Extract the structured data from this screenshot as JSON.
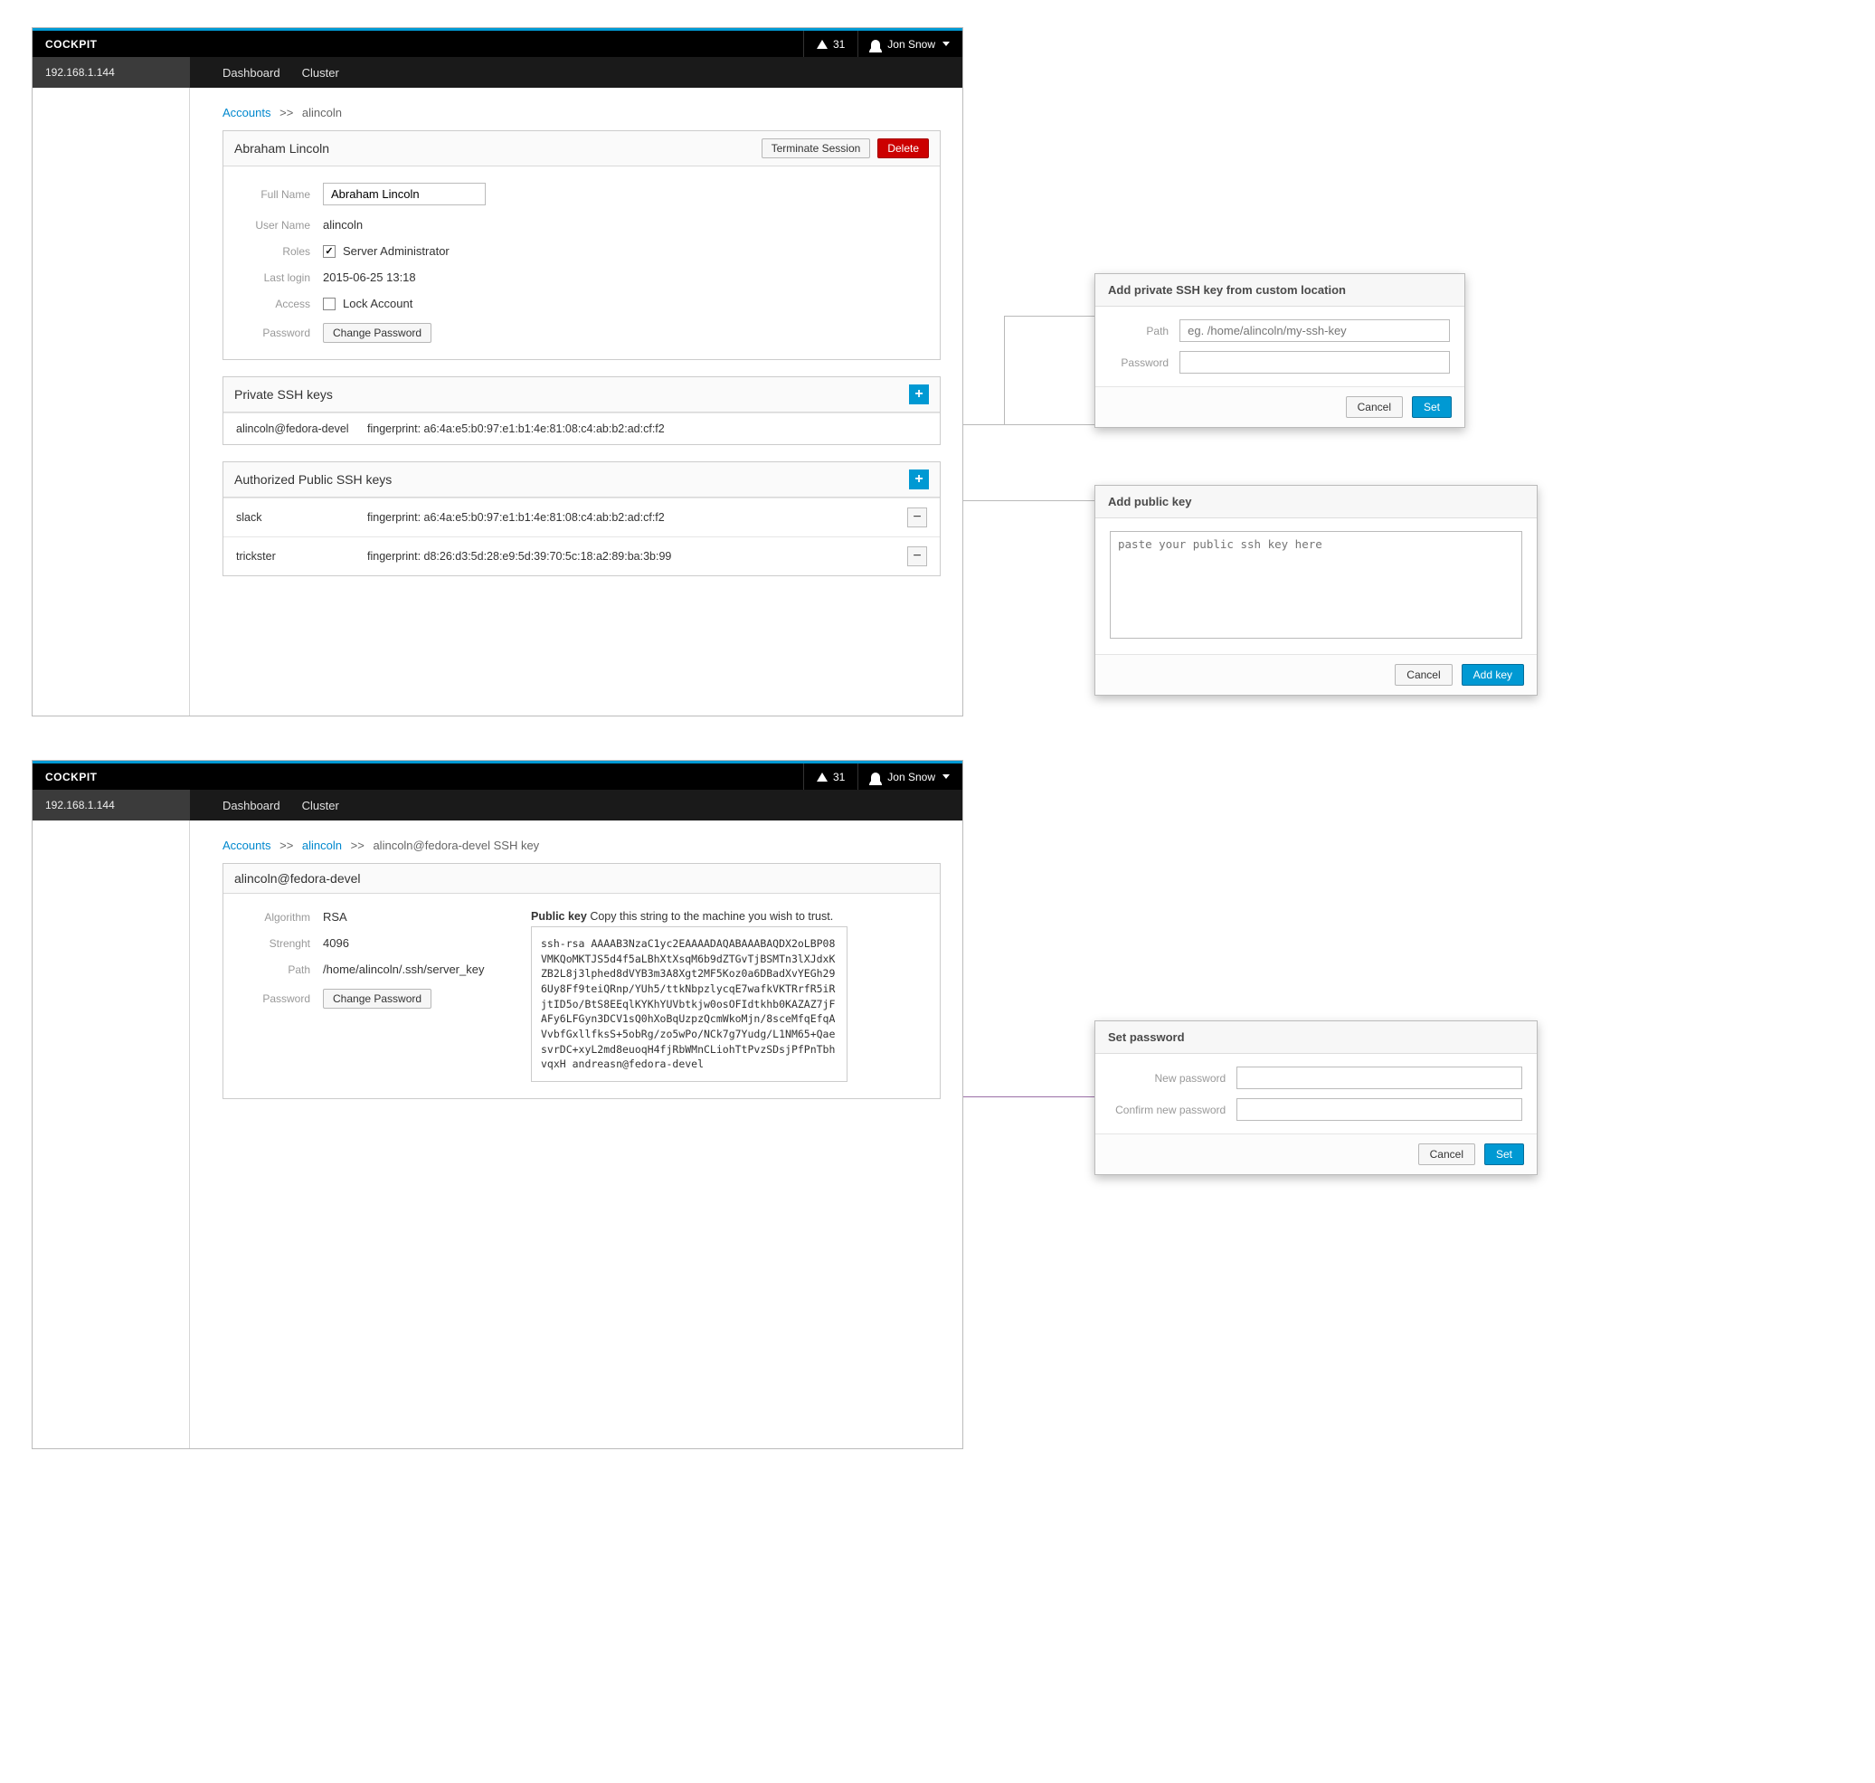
{
  "brand": "COCKPIT",
  "host": "192.168.1.144",
  "alerts": {
    "count": "31"
  },
  "user": {
    "name": "Jon Snow"
  },
  "nav": {
    "dashboard": "Dashboard",
    "cluster": "Cluster"
  },
  "screen1": {
    "breadcrumb": {
      "root": "Accounts",
      "leaf": "alincoln"
    },
    "title": "Abraham Lincoln",
    "actions": {
      "terminate": "Terminate Session",
      "delete": "Delete"
    },
    "fields": {
      "full_name_label": "Full Name",
      "full_name": "Abraham Lincoln",
      "user_name_label": "User Name",
      "user_name": "alincoln",
      "roles_label": "Roles",
      "role_admin": "Server Administrator",
      "last_login_label": "Last login",
      "last_login": "2015-06-25 13:18",
      "access_label": "Access",
      "lock_account": "Lock Account",
      "password_label": "Password",
      "change_password": "Change Password"
    },
    "private_keys": {
      "title": "Private SSH keys",
      "rows": [
        {
          "name": "alincoln@fedora-devel",
          "fp": "fingerprint: a6:4a:e5:b0:97:e1:b1:4e:81:08:c4:ab:b2:ad:cf:f2"
        }
      ]
    },
    "public_keys": {
      "title": "Authorized Public SSH keys",
      "rows": [
        {
          "name": "slack",
          "fp": "fingerprint: a6:4a:e5:b0:97:e1:b1:4e:81:08:c4:ab:b2:ad:cf:f2"
        },
        {
          "name": "trickster",
          "fp": "fingerprint: d8:26:d3:5d:28:e9:5d:39:70:5c:18:a2:89:ba:3b:99"
        }
      ]
    }
  },
  "dialog_private": {
    "title": "Add private SSH key from custom location",
    "path_label": "Path",
    "path_placeholder": "eg. /home/alincoln/my-ssh-key",
    "password_label": "Password",
    "cancel": "Cancel",
    "set": "Set"
  },
  "dialog_public": {
    "title": "Add public key",
    "placeholder": "paste your public ssh key here",
    "cancel": "Cancel",
    "add": "Add key"
  },
  "screen2": {
    "breadcrumb": {
      "root": "Accounts",
      "mid": "alincoln",
      "leaf": "alincoln@fedora-devel SSH key"
    },
    "title": "alincoln@fedora-devel",
    "meta": {
      "algorithm_label": "Algorithm",
      "algorithm": "RSA",
      "strength_label": "Strenght",
      "strength": "4096",
      "path_label": "Path",
      "path": "/home/alincoln/.ssh/server_key",
      "password_label": "Password",
      "change_password": "Change Password"
    },
    "pubkey_label_bold": "Public key",
    "pubkey_label_rest": " Copy this string to the machine you wish to trust.",
    "pubkey": "ssh-rsa AAAAB3NzaC1yc2EAAAADAQABAAABAQDX2oLBP08VMKQoMKTJS5d4f5aLBhXtXsqM6b9dZTGvTjBSMTn3lXJdxKZB2L8j3lphed8dVYB3m3A8Xgt2MF5Koz0a6DBadXvYEGh296Uy8Ff9teiQRnp/YUh5/ttkNbpzlycqE7wafkVKTRrfR5iRjtID5o/BtS8EEqlKYKhYUVbtkjw0osOFIdtkhb0KAZAZ7jFAFy6LFGyn3DCV1sQ0hXoBqUzpzQcmWkoMjn/8sceMfqEfqAVvbfGxllfksS+5obRg/zo5wPo/NCk7g7Yudg/L1NM65+QaesvrDC+xyL2md8euoqH4fjRbWMnCLiohTtPvzSDsjPfPnTbhvqxH andreasn@fedora-devel"
  },
  "dialog_setpw": {
    "title": "Set password",
    "new_label": "New password",
    "confirm_label": "Confirm new password",
    "cancel": "Cancel",
    "set": "Set"
  }
}
